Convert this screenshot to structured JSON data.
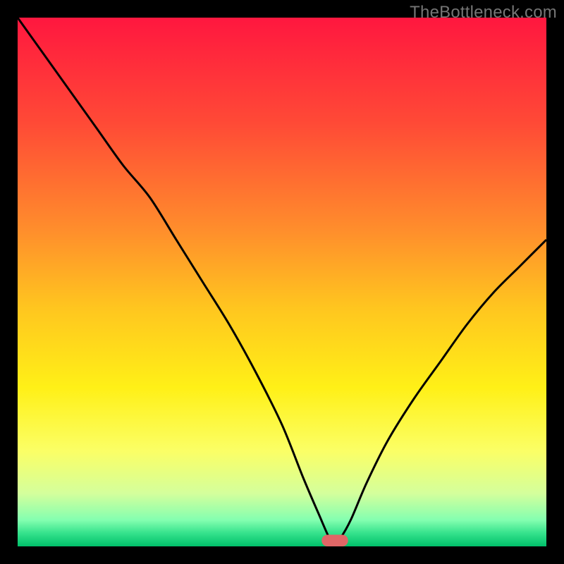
{
  "watermark": "TheBottleneck.com",
  "chart_data": {
    "type": "line",
    "title": "",
    "xlabel": "",
    "ylabel": "",
    "xlim": [
      0,
      100
    ],
    "ylim": [
      0,
      100
    ],
    "grid": false,
    "legend": false,
    "background_gradient_stops": [
      {
        "offset": 0.0,
        "color": "#ff173f"
      },
      {
        "offset": 0.2,
        "color": "#ff4a36"
      },
      {
        "offset": 0.4,
        "color": "#ff8d2c"
      },
      {
        "offset": 0.55,
        "color": "#ffc61f"
      },
      {
        "offset": 0.7,
        "color": "#fff017"
      },
      {
        "offset": 0.82,
        "color": "#fbff66"
      },
      {
        "offset": 0.9,
        "color": "#d4ff9c"
      },
      {
        "offset": 0.95,
        "color": "#84ffb0"
      },
      {
        "offset": 0.975,
        "color": "#35e28c"
      },
      {
        "offset": 1.0,
        "color": "#00c06a"
      }
    ],
    "series": [
      {
        "name": "bottleneck-curve",
        "x": [
          0,
          5,
          10,
          15,
          20,
          25,
          30,
          35,
          40,
          45,
          50,
          54,
          57,
          59,
          60,
          61,
          63,
          66,
          70,
          75,
          80,
          85,
          90,
          95,
          100
        ],
        "y": [
          100,
          93,
          86,
          79,
          72,
          66,
          58,
          50,
          42,
          33,
          23,
          13,
          6,
          1.5,
          0.8,
          1.5,
          5,
          12,
          20,
          28,
          35,
          42,
          48,
          53,
          58
        ]
      }
    ],
    "marker": {
      "name": "optimal-range",
      "x_center": 60,
      "width": 5,
      "height": 2.2,
      "color": "#e06666"
    }
  }
}
